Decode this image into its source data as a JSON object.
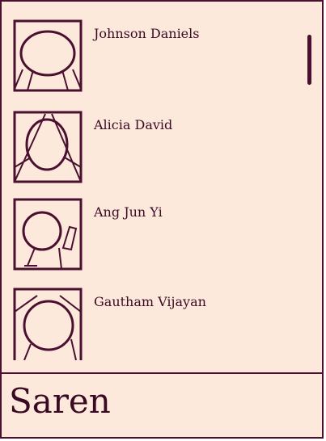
{
  "contacts": [
    {
      "name": "Johnson Daniels",
      "icon": "avatar-placeholder-icon"
    },
    {
      "name": "Alicia David",
      "icon": "avatar-placeholder-icon"
    },
    {
      "name": "Ang Jun Yi",
      "icon": "avatar-placeholder-icon"
    },
    {
      "name": "Gautham Vijayan",
      "icon": "avatar-placeholder-icon"
    }
  ],
  "footer": {
    "name": "Saren"
  },
  "colors": {
    "background": "#fde9dc",
    "ink": "#4a1030"
  }
}
